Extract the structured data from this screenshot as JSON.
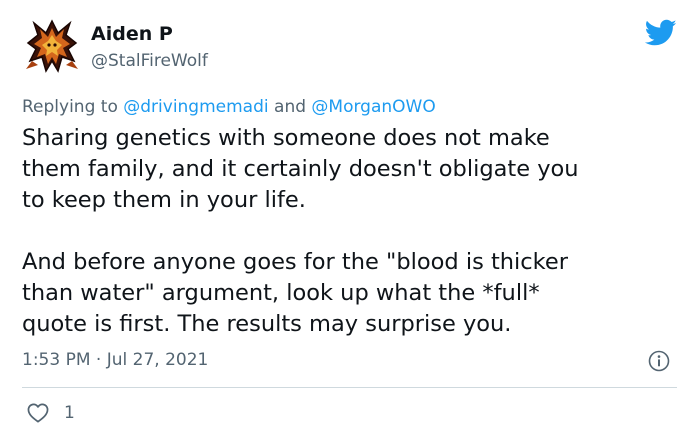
{
  "tweet": {
    "author": {
      "display_name": "Aiden P",
      "handle": "@StalFireWolf",
      "avatar_icon": "fire-wolf-avatar-icon"
    },
    "brand_icon": "twitter-bird-icon",
    "reply_to": {
      "prefix": "Replying to",
      "mention_1": "@drivingmemadi",
      "conjunction": "and",
      "mention_2": "@MorganOWO"
    },
    "body_lines": [
      "Sharing genetics with someone does not make",
      "them family, and it certainly doesn't obligate you",
      "to keep them in your life.",
      "And before anyone goes for the \"blood is thicker",
      "than water\" argument, look up what the *full*",
      "quote is first. The results may surprise you."
    ],
    "timestamp": "1:53 PM · Jul 27, 2021",
    "likes": "1",
    "colors": {
      "accent": "#1d9bf0",
      "secondary_text": "#536471",
      "divider": "#cfd9de"
    }
  }
}
